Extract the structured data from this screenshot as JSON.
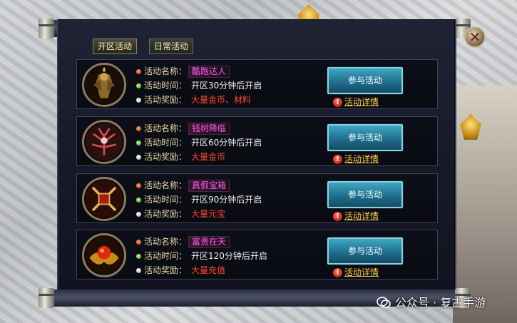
{
  "tabs": [
    {
      "label": "开区活动",
      "active": true
    },
    {
      "label": "日常活动",
      "active": false
    }
  ],
  "field_labels": {
    "name": "活动名称",
    "time": "活动时间",
    "reward": "活动奖励",
    "colon": "："
  },
  "activities": [
    {
      "name": "酷跑达人",
      "time": "开区30分钟后开启",
      "reward": "大量金币、材料",
      "join_label": "参与活动",
      "detail_label": "活动详情",
      "icon": "warrior-portrait-icon"
    },
    {
      "name": "钱树降临",
      "time": "开区60分钟后开启",
      "reward": "大量金币",
      "join_label": "参与活动",
      "detail_label": "活动详情",
      "icon": "thorn-tree-portrait-icon"
    },
    {
      "name": "真假宝箱",
      "time": "开区90分钟后开启",
      "reward": "大量元宝",
      "join_label": "参与活动",
      "detail_label": "活动详情",
      "icon": "crossed-swords-portrait-icon"
    },
    {
      "name": "富贵在天",
      "time": "开区120分钟后开启",
      "reward": "大量充值",
      "join_label": "参与活动",
      "detail_label": "活动详情",
      "icon": "golden-orb-portrait-icon"
    }
  ],
  "close_label": "✕",
  "watermark": "公众号 · 复古手游",
  "colors": {
    "name_text": "#ff5cf0",
    "reward_text": "#ff4a32",
    "label_text": "#e8d8a6",
    "button_blue": "#1f6f8e",
    "detail_yellow": "#ffd24a"
  }
}
